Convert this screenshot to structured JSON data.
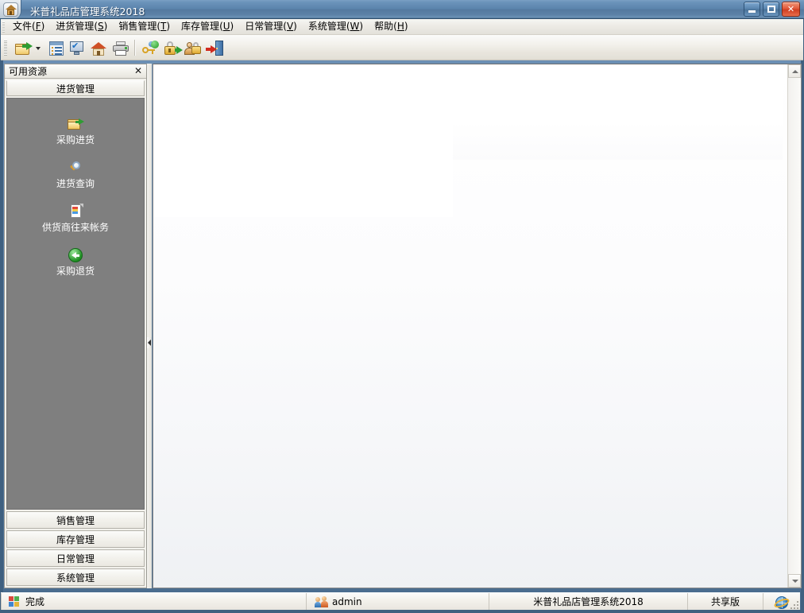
{
  "window": {
    "title": "米普礼品店管理系统2018",
    "app_icon": "home-icon",
    "buttons": {
      "minimize": "minimize-button",
      "maximize": "maximize-button",
      "close": "close-button",
      "close_glyph": "✕"
    }
  },
  "menubar": {
    "items": [
      {
        "text": "文件(F)",
        "label": "文件",
        "accel": "F"
      },
      {
        "text": "进货管理(S)",
        "label": "进货管理",
        "accel": "S"
      },
      {
        "text": "销售管理(T)",
        "label": "销售管理",
        "accel": "T"
      },
      {
        "text": "库存管理(U)",
        "label": "库存管理",
        "accel": "U"
      },
      {
        "text": "日常管理(V)",
        "label": "日常管理",
        "accel": "V"
      },
      {
        "text": "系统管理(W)",
        "label": "系统管理",
        "accel": "W"
      },
      {
        "text": "帮助(H)",
        "label": "帮助",
        "accel": "H"
      }
    ]
  },
  "toolbar": {
    "buttons": [
      {
        "name": "open-folder-icon"
      },
      {
        "name": "dropdown-caret-icon"
      },
      {
        "name": "list-view-icon"
      },
      {
        "name": "computer-check-icon"
      },
      {
        "name": "home-icon"
      },
      {
        "name": "print-icon"
      },
      {
        "name": "key-user-icon"
      },
      {
        "name": "lock-export-icon"
      },
      {
        "name": "user-lock-icon"
      },
      {
        "name": "exit-door-icon"
      }
    ]
  },
  "sidebar": {
    "caption": "可用资源",
    "close_glyph": "✕",
    "active_group": "进货管理",
    "entries": [
      {
        "label": "采购进货",
        "icon": "folder-import-icon"
      },
      {
        "label": "进货查询",
        "icon": "magnifier-icon"
      },
      {
        "label": "供货商往来帐务",
        "icon": "document-account-icon"
      },
      {
        "label": "采购退货",
        "icon": "green-back-arrow-icon"
      }
    ],
    "groups": [
      {
        "label": "销售管理"
      },
      {
        "label": "库存管理"
      },
      {
        "label": "日常管理"
      },
      {
        "label": "系统管理"
      }
    ]
  },
  "statusbar": {
    "status_text": "完成",
    "status_icon": "windows-flag-icon",
    "user": "admin",
    "user_icon": "users-icon",
    "product": "米普礼品店管理系统2018",
    "edition": "共享版",
    "globe_icon": "globe-icon"
  },
  "scrollbar": {
    "up_arrow": "scroll-up-arrow-icon",
    "down_arrow": "scroll-down-arrow-icon"
  },
  "splitter": {
    "collapse_icon": "collapse-left-arrow-icon"
  },
  "colors": {
    "titlebar_start": "#7ba0c4",
    "titlebar_end": "#43657f",
    "window_border": "#3f6080",
    "sidebar_body": "#7f7f7f",
    "close_button": "#cf3f21"
  }
}
